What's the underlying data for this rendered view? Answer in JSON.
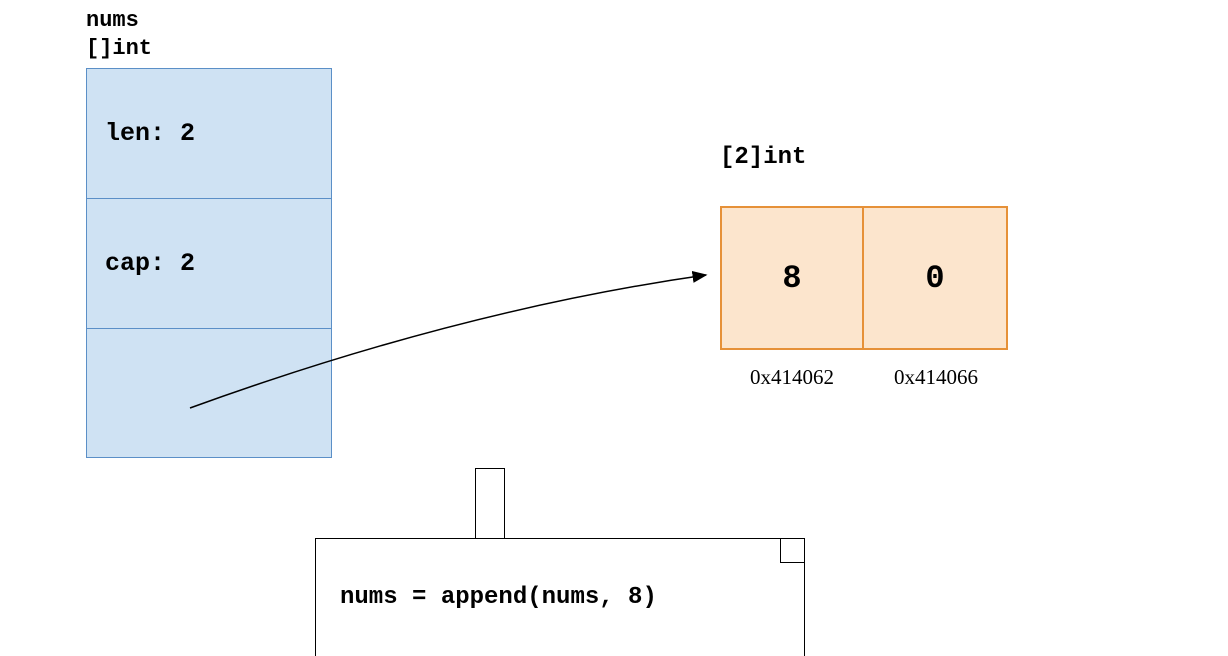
{
  "slice": {
    "name": "nums",
    "type": "[]int",
    "len_label": "len: 2",
    "cap_label": "cap: 2"
  },
  "array": {
    "type": "[2]int",
    "cells": [
      "8",
      "0"
    ],
    "addresses": [
      "0x414062",
      "0x414066"
    ]
  },
  "note": {
    "code": "nums = append(nums, 8)"
  }
}
